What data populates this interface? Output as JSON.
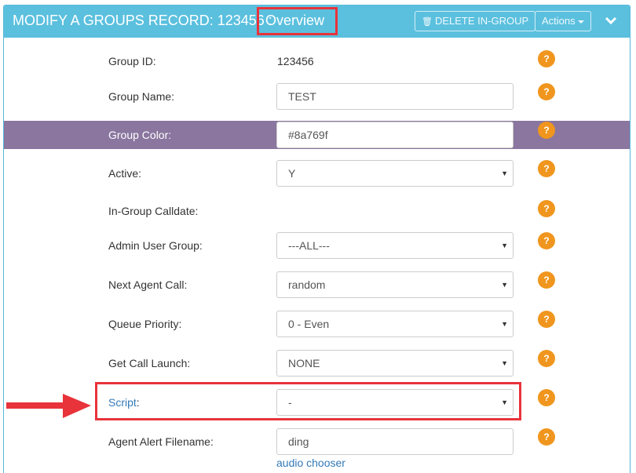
{
  "header": {
    "title": "MODIFY A GROUPS RECORD: 123456",
    "sep": " : ",
    "overview": "Overview",
    "delete_label": "DELETE IN-GROUP",
    "actions_label": "Actions"
  },
  "fields": {
    "group_id": {
      "label": "Group ID:",
      "value": "123456"
    },
    "group_name": {
      "label": "Group Name:",
      "value": "TEST"
    },
    "group_color": {
      "label": "Group Color:",
      "value": "#8a769f"
    },
    "active": {
      "label": "Active:",
      "value": "Y"
    },
    "calldate": {
      "label": "In-Group Calldate:"
    },
    "admin_user_group": {
      "label": "Admin User Group:",
      "value": "---ALL---"
    },
    "next_agent_call": {
      "label": "Next Agent Call:",
      "value": "random"
    },
    "queue_priority": {
      "label": "Queue Priority:",
      "value": "0 - Even"
    },
    "get_call_launch": {
      "label": "Get Call Launch:",
      "value": "NONE"
    },
    "script": {
      "label": "Script",
      "colon": ":",
      "value": "-"
    },
    "agent_alert": {
      "label": "Agent Alert Filename:",
      "value": "ding",
      "link": "audio chooser"
    }
  },
  "help_glyph": "?",
  "colors": {
    "header_bg": "#5bc0de",
    "highlight_row": "#8a769f",
    "help_badge": "#f0961e",
    "annotation_red": "#e8333b",
    "link": "#337ab7"
  },
  "icons": [
    "trash-icon",
    "caret-down-icon",
    "chevron-down-icon",
    "help-icon",
    "select-arrow-icon",
    "red-arrow-icon"
  ]
}
